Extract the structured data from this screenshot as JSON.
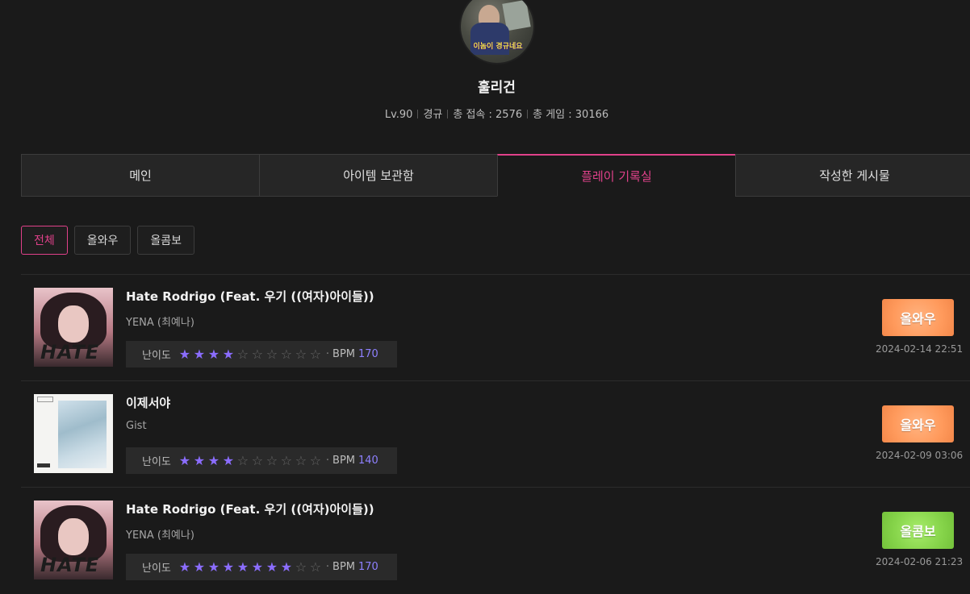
{
  "profile": {
    "nickname": "훌리건",
    "level": "Lv.90",
    "rank": "경규",
    "total_visits": "총 접속 : 2576",
    "total_games": "총 게임 : 30166",
    "avatar_caption": "이놈이 경규네요"
  },
  "tabs": [
    {
      "label": "메인",
      "active": false
    },
    {
      "label": "아이템 보관함",
      "active": false
    },
    {
      "label": "플레이 기록실",
      "active": true
    },
    {
      "label": "작성한 게시물",
      "active": false
    }
  ],
  "filters": [
    {
      "label": "전체",
      "active": true
    },
    {
      "label": "올와우",
      "active": false
    },
    {
      "label": "올콤보",
      "active": false
    }
  ],
  "difficulty_label": "난이도",
  "bpm_label": "BPM",
  "records": [
    {
      "title": "Hate Rodrigo (Feat. 우기 ((여자)아이들))",
      "artist": "YENA (최예나)",
      "difficulty": 4,
      "max_difficulty": 10,
      "bpm": "170",
      "badge": "올와우",
      "badge_color": "#ff9a5c",
      "date": "2024-02-14 22:51",
      "cover": "hate"
    },
    {
      "title": "이제서야",
      "artist": "Gist",
      "difficulty": 4,
      "max_difficulty": 10,
      "bpm": "140",
      "badge": "올와우",
      "badge_color": "#ff9a5c",
      "date": "2024-02-09 03:06",
      "cover": "gist"
    },
    {
      "title": "Hate Rodrigo (Feat. 우기 ((여자)아이들))",
      "artist": "YENA (최예나)",
      "difficulty": 8,
      "max_difficulty": 10,
      "bpm": "170",
      "badge": "올콤보",
      "badge_color": "#86d44a",
      "date": "2024-02-06 21:23",
      "cover": "hate"
    }
  ],
  "cover_text": {
    "hate": "HATE"
  },
  "colors": {
    "accent": "#e0418a",
    "star": "#8b6dff",
    "bpm": "#8e80ff"
  }
}
